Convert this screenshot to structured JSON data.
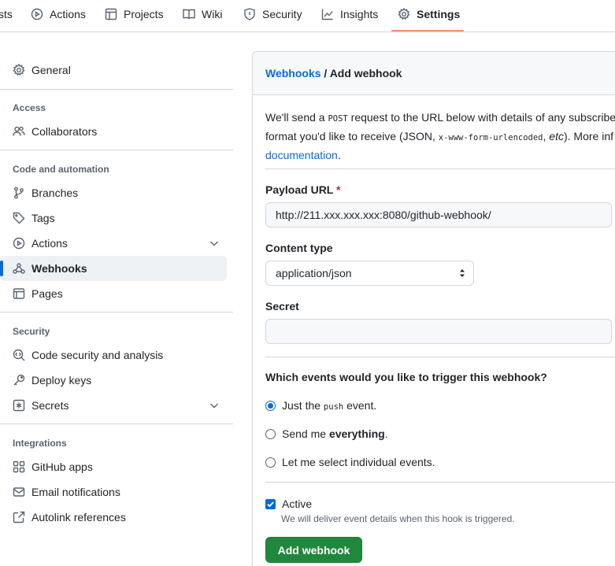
{
  "colors": {
    "accent": "#0969da",
    "tab_underline": "#fd8c73",
    "primary_button": "#1f883d",
    "required": "#cf222e"
  },
  "repo_nav": {
    "tabs": [
      {
        "label": "sts",
        "icon": "cut-off"
      },
      {
        "label": "Actions",
        "icon": "play-icon"
      },
      {
        "label": "Projects",
        "icon": "table-icon"
      },
      {
        "label": "Wiki",
        "icon": "book-icon"
      },
      {
        "label": "Security",
        "icon": "shield-icon"
      },
      {
        "label": "Insights",
        "icon": "graph-icon"
      },
      {
        "label": "Settings",
        "icon": "gear-icon",
        "selected": true
      }
    ]
  },
  "sidebar": {
    "general": "General",
    "group_access": "Access",
    "collaborators": "Collaborators",
    "group_code": "Code and automation",
    "branches": "Branches",
    "tags": "Tags",
    "actions": "Actions",
    "webhooks": "Webhooks",
    "pages": "Pages",
    "group_security": "Security",
    "code_security": "Code security and analysis",
    "deploy_keys": "Deploy keys",
    "secrets": "Secrets",
    "group_integrations": "Integrations",
    "github_apps": "GitHub apps",
    "email_notifications": "Email notifications",
    "autolink_references": "Autolink references"
  },
  "main": {
    "breadcrumb_link": "Webhooks",
    "breadcrumb_sep": " / ",
    "breadcrumb_current": "Add webhook",
    "intro_1a": "We'll send a ",
    "intro_post": "POST",
    "intro_1b": " request to the URL below with details of any subscribed",
    "intro_2a": "format you'd like to receive (JSON, ",
    "intro_form": "x-www-form-urlencoded",
    "intro_2b": ", ",
    "intro_etc": "etc",
    "intro_2c": "). More inf",
    "intro_doc_link": "documentation",
    "intro_3": ".",
    "payload_label": "Payload URL",
    "required_mark": "*",
    "payload_value": "http://211.xxx.xxx.xxx:8080/github-webhook/",
    "content_type_label": "Content type",
    "content_type_value": "application/json",
    "secret_label": "Secret",
    "secret_value": "",
    "events_question": "Which events would you like to trigger this webhook?",
    "event_push_a": "Just the ",
    "event_push_code": "push",
    "event_push_b": " event.",
    "event_all_a": "Send me ",
    "event_all_b": "everything",
    "event_all_c": ".",
    "event_individual": "Let me select individual events.",
    "selected_event": "push",
    "active_label": "Active",
    "active_checked": true,
    "active_note": "We will deliver event details when this hook is triggered.",
    "submit_label": "Add webhook"
  }
}
